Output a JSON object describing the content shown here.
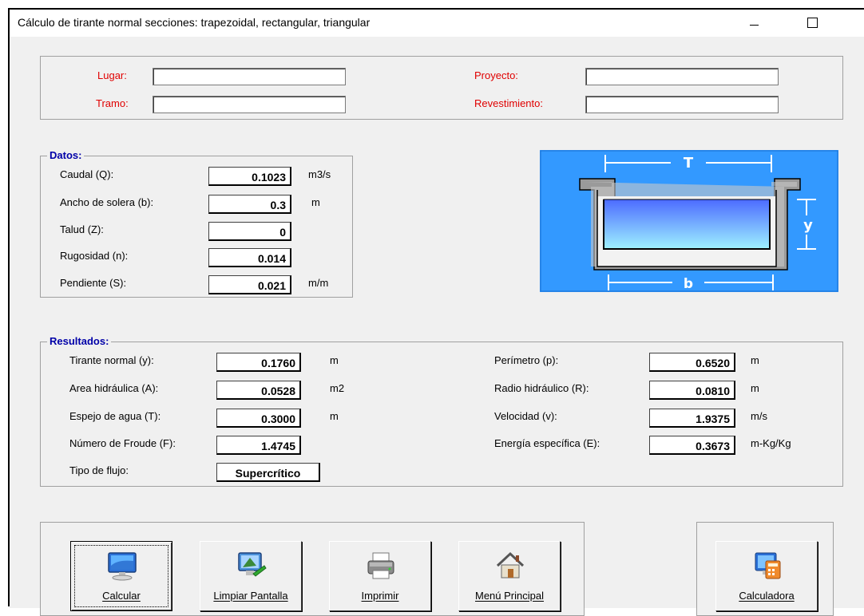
{
  "window": {
    "title": "Cálculo de tirante normal secciones: trapezoidal, rectangular, triangular"
  },
  "info": {
    "lugar_label": "Lugar:",
    "tramo_label": "Tramo:",
    "proyecto_label": "Proyecto:",
    "revestimiento_label": "Revestimiento:",
    "lugar_value": "",
    "tramo_value": "",
    "proyecto_value": "",
    "revestimiento_value": ""
  },
  "datos": {
    "legend": "Datos:",
    "rows": [
      {
        "label": "Caudal (Q):",
        "value": "0.1023",
        "unit": "m3/s"
      },
      {
        "label": "Ancho de solera (b):",
        "value": "0.3",
        "unit": "m"
      },
      {
        "label": "Talud (Z):",
        "value": "0",
        "unit": ""
      },
      {
        "label": "Rugosidad (n):",
        "value": "0.014",
        "unit": ""
      },
      {
        "label": "Pendiente (S):",
        "value": "0.021",
        "unit": "m/m"
      }
    ]
  },
  "diagram": {
    "top_label": "T",
    "right_label": "y",
    "bottom_label": "b"
  },
  "resultados": {
    "legend": "Resultados:",
    "left": [
      {
        "label": "Tirante normal (y):",
        "value": "0.1760",
        "unit": "m"
      },
      {
        "label": "Area hidráulica (A):",
        "value": "0.0528",
        "unit": "m2"
      },
      {
        "label": "Espejo de agua (T):",
        "value": "0.3000",
        "unit": "m"
      },
      {
        "label": "Número de Froude (F):",
        "value": "1.4745",
        "unit": ""
      },
      {
        "label": "Tipo de flujo:",
        "value": "Supercrítico",
        "unit": ""
      }
    ],
    "right": [
      {
        "label": "Perímetro (p):",
        "value": "0.6520",
        "unit": "m"
      },
      {
        "label": "Radio hidráulico (R):",
        "value": "0.0810",
        "unit": "m"
      },
      {
        "label": "Velocidad (v):",
        "value": "1.9375",
        "unit": "m/s"
      },
      {
        "label": "Energía específica (E):",
        "value": "0.3673",
        "unit": "m-Kg/Kg"
      }
    ]
  },
  "buttons": {
    "calcular": "Calcular",
    "limpiar": "Limpiar Pantalla",
    "imprimir": "Imprimir",
    "menu": "Menú Principal",
    "calculadora": "Calculadora"
  },
  "colors": {
    "label_red": "#e00000",
    "legend_blue": "#0000a8",
    "diagram_bg": "#3399ff"
  },
  "icons": {
    "calcular": "monitor-icon",
    "limpiar": "clean-screen-icon",
    "imprimir": "printer-icon",
    "menu": "home-icon",
    "calculadora": "calculator-computer-icon"
  }
}
